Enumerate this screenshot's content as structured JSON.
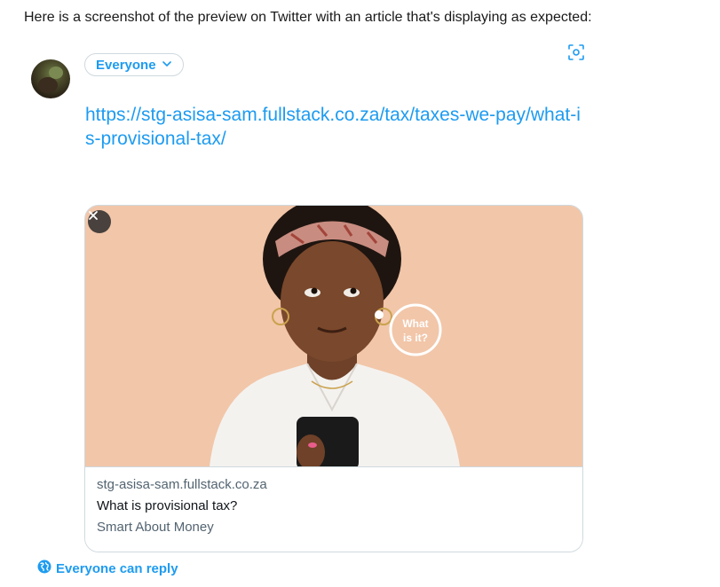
{
  "intro_text": "Here is a screenshot of the preview on Twitter with an article that's displaying as expected:",
  "composer": {
    "audience_label": "Everyone",
    "tweet_url": "https://stg-asisa-sam.fullstack.co.za/tax/taxes-we-pay/what-is-provisional-tax/"
  },
  "link_card": {
    "image_bubble_text_line1": "What",
    "image_bubble_text_line2": "is it?",
    "domain": "stg-asisa-sam.fullstack.co.za",
    "title": "What is provisional tax?",
    "description": "Smart About Money"
  },
  "reply_setting": "Everyone can reply",
  "colors": {
    "accent": "#1d9bf0",
    "muted_text": "#536471",
    "border": "#cfd9de",
    "card_image_bg": "#f2c6a9"
  },
  "icons": [
    "chevron-down-icon",
    "scan-icon",
    "close-icon",
    "globe-icon"
  ]
}
